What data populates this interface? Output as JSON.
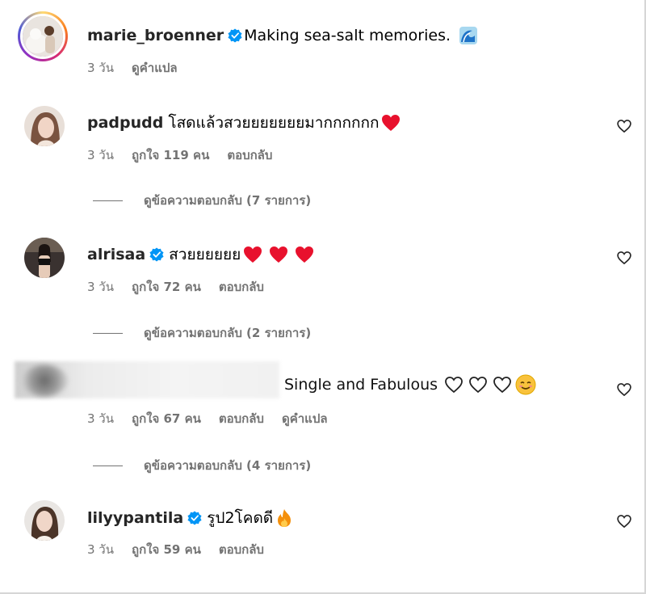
{
  "comments": [
    {
      "username": "marie_broenner",
      "verified": true,
      "text": "Making sea-salt memories.",
      "emoji": "wave-icon",
      "time": "3 วัน",
      "translate": "ดูคำแปล"
    },
    {
      "username": "padpudd",
      "verified": false,
      "text": "โสดแล้วสวยยยยยยยมากกกกกก",
      "emoji": "red-heart-icon",
      "time": "3 วัน",
      "likes": "ถูกใจ 119 คน",
      "reply": "ตอบกลับ",
      "view_replies": "ดูข้อความตอบกลับ (7 รายการ)"
    },
    {
      "username": "alrisaa",
      "verified": true,
      "text": "สวยยยยยย",
      "emoji": "red-heart-icon x3",
      "time": "3 วัน",
      "likes": "ถูกใจ 72 คน",
      "reply": "ตอบกลับ",
      "view_replies": "ดูข้อความตอบกลับ (2 รายการ)"
    },
    {
      "username": "",
      "verified": false,
      "text": "Single and Fabulous",
      "emoji": "white-heart-icon x3, smiling-face-icon",
      "time": "3 วัน",
      "likes": "ถูกใจ 67 คน",
      "reply": "ตอบกลับ",
      "translate": "ดูคำแปล",
      "view_replies": "ดูข้อความตอบกลับ (4 รายการ)"
    },
    {
      "username": "lilyypantila",
      "verified": true,
      "text": "รูป2โคดดี",
      "emoji": "fire-icon",
      "time": "3 วัน",
      "likes": "ถูกใจ 59 คน",
      "reply": "ตอบกลับ"
    }
  ],
  "colors": {
    "verified": "#0095f6",
    "heart": "#e8112d",
    "muted": "#737373"
  }
}
